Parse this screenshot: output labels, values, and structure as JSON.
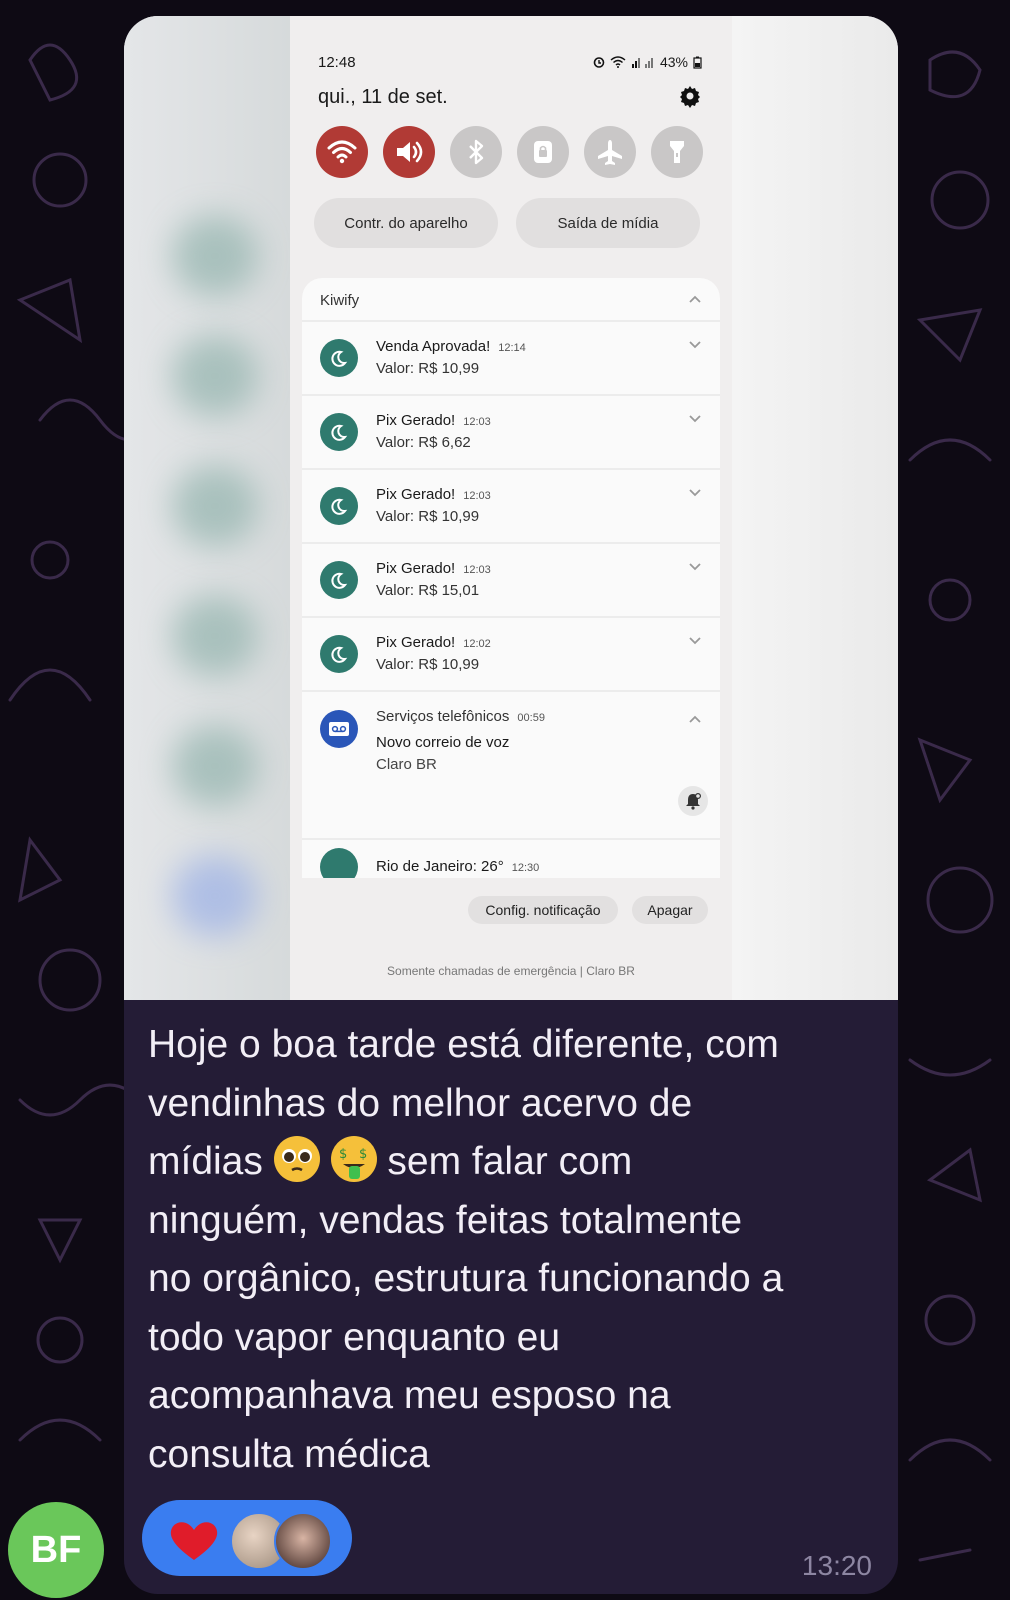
{
  "colors": {
    "chat_background": "#0e0a14",
    "bubble": "#241c36",
    "message_text": "#f2eef6",
    "reaction_pill": "#3a7df0",
    "avatar_bg": "#6ac75a",
    "qs_active": "#b13a35",
    "notif_icon": "#2f7a6e"
  },
  "screenshot": {
    "status_bar": {
      "time": "12:48",
      "battery": "43%",
      "icons": [
        "alarm-icon",
        "wifi-icon",
        "signal-icon",
        "battery-icon"
      ]
    },
    "date": "qui., 11 de set.",
    "quick_settings": [
      {
        "icon": "wifi-icon",
        "active": true
      },
      {
        "icon": "sound-icon",
        "active": true
      },
      {
        "icon": "bluetooth-icon",
        "active": false
      },
      {
        "icon": "rotation-lock-icon",
        "active": false
      },
      {
        "icon": "airplane-icon",
        "active": false
      },
      {
        "icon": "flashlight-icon",
        "active": false
      }
    ],
    "pills": {
      "device_control": "Contr. do aparelho",
      "media_output": "Saída de mídia"
    },
    "kiwify": {
      "app_name": "Kiwify",
      "items": [
        {
          "title": "Venda Aprovada!",
          "time": "12:14",
          "value": "Valor: R$ 10,99"
        },
        {
          "title": "Pix Gerado!",
          "time": "12:03",
          "value": "Valor: R$ 6,62"
        },
        {
          "title": "Pix Gerado!",
          "time": "12:03",
          "value": "Valor: R$ 10,99"
        },
        {
          "title": "Pix Gerado!",
          "time": "12:03",
          "value": "Valor: R$ 15,01"
        },
        {
          "title": "Pix Gerado!",
          "time": "12:02",
          "value": "Valor: R$ 10,99"
        }
      ]
    },
    "phone_services": {
      "title": "Serviços telefônicos",
      "time": "00:59",
      "line1": "Novo correio de voz",
      "line2": "Claro BR"
    },
    "partial": {
      "title": "Rio de Janeiro: 26°",
      "time": "12:30"
    },
    "buttons": {
      "notif_settings": "Config. notificação",
      "clear": "Apagar"
    },
    "emergency": "Somente chamadas de emergência | Claro BR"
  },
  "message": {
    "part1": "Hoje o boa tarde está diferente, com\nvendinhas do melhor acervo de\nmídias ",
    "emoji1": "pleading-face-emoji",
    "emoji2": "money-mouth-face-emoji",
    "part2": " sem falar com\nninguém, vendas feitas totalmente\nno orgânico, estrutura funcionando a\ntodo vapor enquanto eu\nacompanhava meu esposo na\nconsulta médica",
    "time": "13:20"
  },
  "reactions": {
    "emoji": "heart-icon",
    "count_avatars": 2
  },
  "sender": {
    "initials": "BF"
  }
}
